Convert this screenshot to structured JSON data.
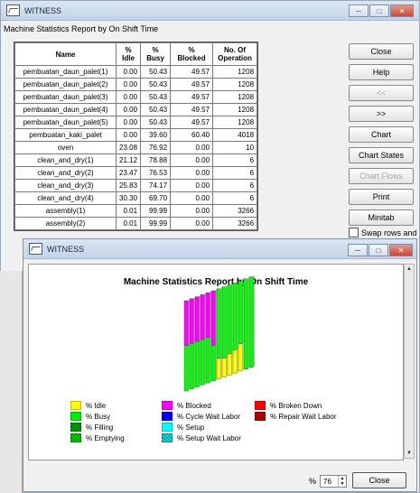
{
  "main_window": {
    "title": "WITNESS",
    "subtitle": "Machine Statistics  Report by On Shift Time",
    "controls": [
      "minimize-icon",
      "maximize-icon",
      "close-icon"
    ]
  },
  "table": {
    "headers": [
      "Name",
      "%\nIdle",
      "%\nBusy",
      "%\nBlocked",
      "No. Of\nOperation"
    ],
    "rows": [
      [
        "pembuatan_daun_palet(1)",
        "0.00",
        "50.43",
        "49.57",
        "1208"
      ],
      [
        "pembuatan_daun_palet(2)",
        "0.00",
        "50.43",
        "49.57",
        "1208"
      ],
      [
        "pembuatan_daun_palet(3)",
        "0.00",
        "50.43",
        "49.57",
        "1208"
      ],
      [
        "pembuatan_daun_palet(4)",
        "0.00",
        "50.43",
        "49.57",
        "1208"
      ],
      [
        "pembuatan_daun_palet(5)",
        "0.00",
        "50.43",
        "49.57",
        "1208"
      ],
      [
        "pembuatan_kaki_palet",
        "0.00",
        "39.60",
        "60.40",
        "4018"
      ],
      [
        "oven",
        "23.08",
        "76.92",
        "0.00",
        "10"
      ],
      [
        "clean_and_dry(1)",
        "21.12",
        "78.88",
        "0.00",
        "6"
      ],
      [
        "clean_and_dry(2)",
        "23.47",
        "76.53",
        "0.00",
        "6"
      ],
      [
        "clean_and_dry(3)",
        "25.83",
        "74.17",
        "0.00",
        "6"
      ],
      [
        "clean_and_dry(4)",
        "30.30",
        "69.70",
        "0.00",
        "6"
      ],
      [
        "assembly(1)",
        "0.01",
        "99.99",
        "0.00",
        "3266"
      ],
      [
        "assembly(2)",
        "0.01",
        "99.99",
        "0.00",
        "3266"
      ]
    ]
  },
  "side_buttons": [
    {
      "label": "Close",
      "enabled": true
    },
    {
      "label": "Help",
      "enabled": true
    },
    {
      "label": "<<",
      "enabled": false
    },
    {
      "label": ">>",
      "enabled": true
    },
    {
      "label": "Chart",
      "enabled": true
    },
    {
      "label": "Chart States",
      "enabled": true
    },
    {
      "label": "Chart Flows",
      "enabled": false
    },
    {
      "label": "Print",
      "enabled": true
    },
    {
      "label": "Minitab",
      "enabled": true
    }
  ],
  "swap_rows_label": "Swap rows and",
  "chart_window": {
    "title": "WITNESS",
    "chart_title": "Machine Statistics   Report by On Shift Time",
    "zoom_label": "%",
    "zoom_value": "76",
    "close_label": "Close"
  },
  "chart_data": {
    "type": "bar",
    "stacked": true,
    "title": "Machine Statistics   Report by On Shift Time",
    "categories": [
      "pembuatan_daun_palet(1)",
      "pembuatan_daun_palet(2)",
      "pembuatan_daun_palet(3)",
      "pembuatan_daun_palet(4)",
      "pembuatan_daun_palet(5)",
      "pembuatan_kaki_palet",
      "oven",
      "clean_and_dry(1)",
      "clean_and_dry(2)",
      "clean_and_dry(3)",
      "clean_and_dry(4)",
      "assembly(1)",
      "assembly(2)"
    ],
    "series": [
      {
        "name": "% Idle",
        "color": "#ffff00",
        "values": [
          0.0,
          0.0,
          0.0,
          0.0,
          0.0,
          0.0,
          23.08,
          21.12,
          23.47,
          25.83,
          30.3,
          0.01,
          0.01
        ]
      },
      {
        "name": "% Busy",
        "color": "#00ff00",
        "values": [
          50.43,
          50.43,
          50.43,
          50.43,
          50.43,
          39.6,
          76.92,
          78.88,
          76.53,
          74.17,
          69.7,
          99.99,
          99.99
        ]
      },
      {
        "name": "% Blocked",
        "color": "#ff00ff",
        "values": [
          49.57,
          49.57,
          49.57,
          49.57,
          49.57,
          60.4,
          0.0,
          0.0,
          0.0,
          0.0,
          0.0,
          0.0,
          0.0
        ]
      }
    ],
    "legend": [
      {
        "name": "% Idle",
        "color": "#ffff00"
      },
      {
        "name": "% Busy",
        "color": "#00ee00"
      },
      {
        "name": "% Filling",
        "color": "#00a000"
      },
      {
        "name": "% Emptying",
        "color": "#00cc00"
      },
      {
        "name": "% Blocked",
        "color": "#ff00ff"
      },
      {
        "name": "% Cycle Wait Labor",
        "color": "#0000ff"
      },
      {
        "name": "% Setup",
        "color": "#00ffff"
      },
      {
        "name": "% Setup Wait Labor",
        "color": "#00dddd"
      },
      {
        "name": "% Broken Down",
        "color": "#ff0000"
      },
      {
        "name": "% Repair Wait Labor",
        "color": "#aa0000"
      }
    ],
    "ylim": [
      0,
      100
    ],
    "legend_placement": "bottom"
  }
}
